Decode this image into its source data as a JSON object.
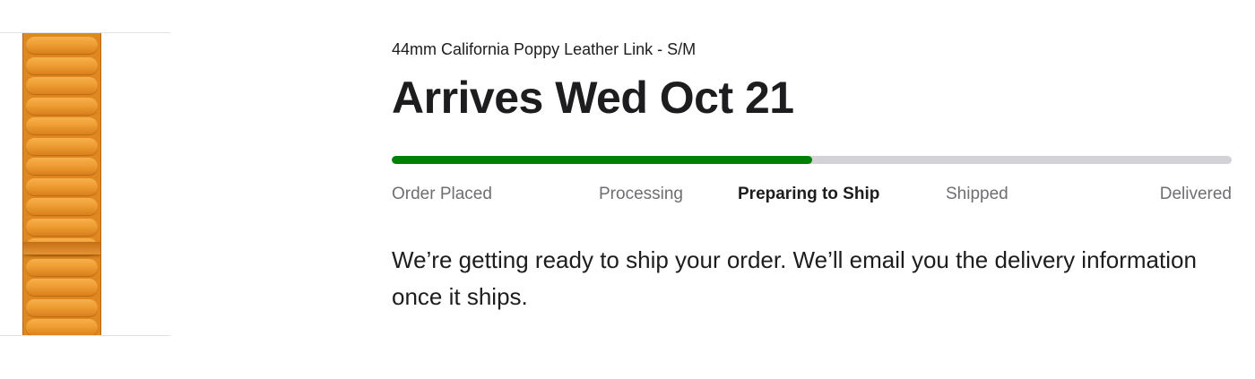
{
  "product": {
    "image_icon": "leather-link-band-image",
    "band_color": "#e0881f"
  },
  "order": {
    "product_name": "44mm California Poppy Leather Link - S/M",
    "arrival_title": "Arrives Wed Oct 21",
    "progress_fraction": 0.5,
    "progress_color": "#008009",
    "track_color": "#d2d2d7",
    "steps": [
      {
        "label": "Order Placed",
        "active": false
      },
      {
        "label": "Processing",
        "active": false
      },
      {
        "label": "Preparing to Ship",
        "active": true
      },
      {
        "label": "Shipped",
        "active": false
      },
      {
        "label": "Delivered",
        "active": false
      }
    ],
    "status_message": "We’re getting ready to ship your order. We’ll email you the delivery information once it ships."
  }
}
